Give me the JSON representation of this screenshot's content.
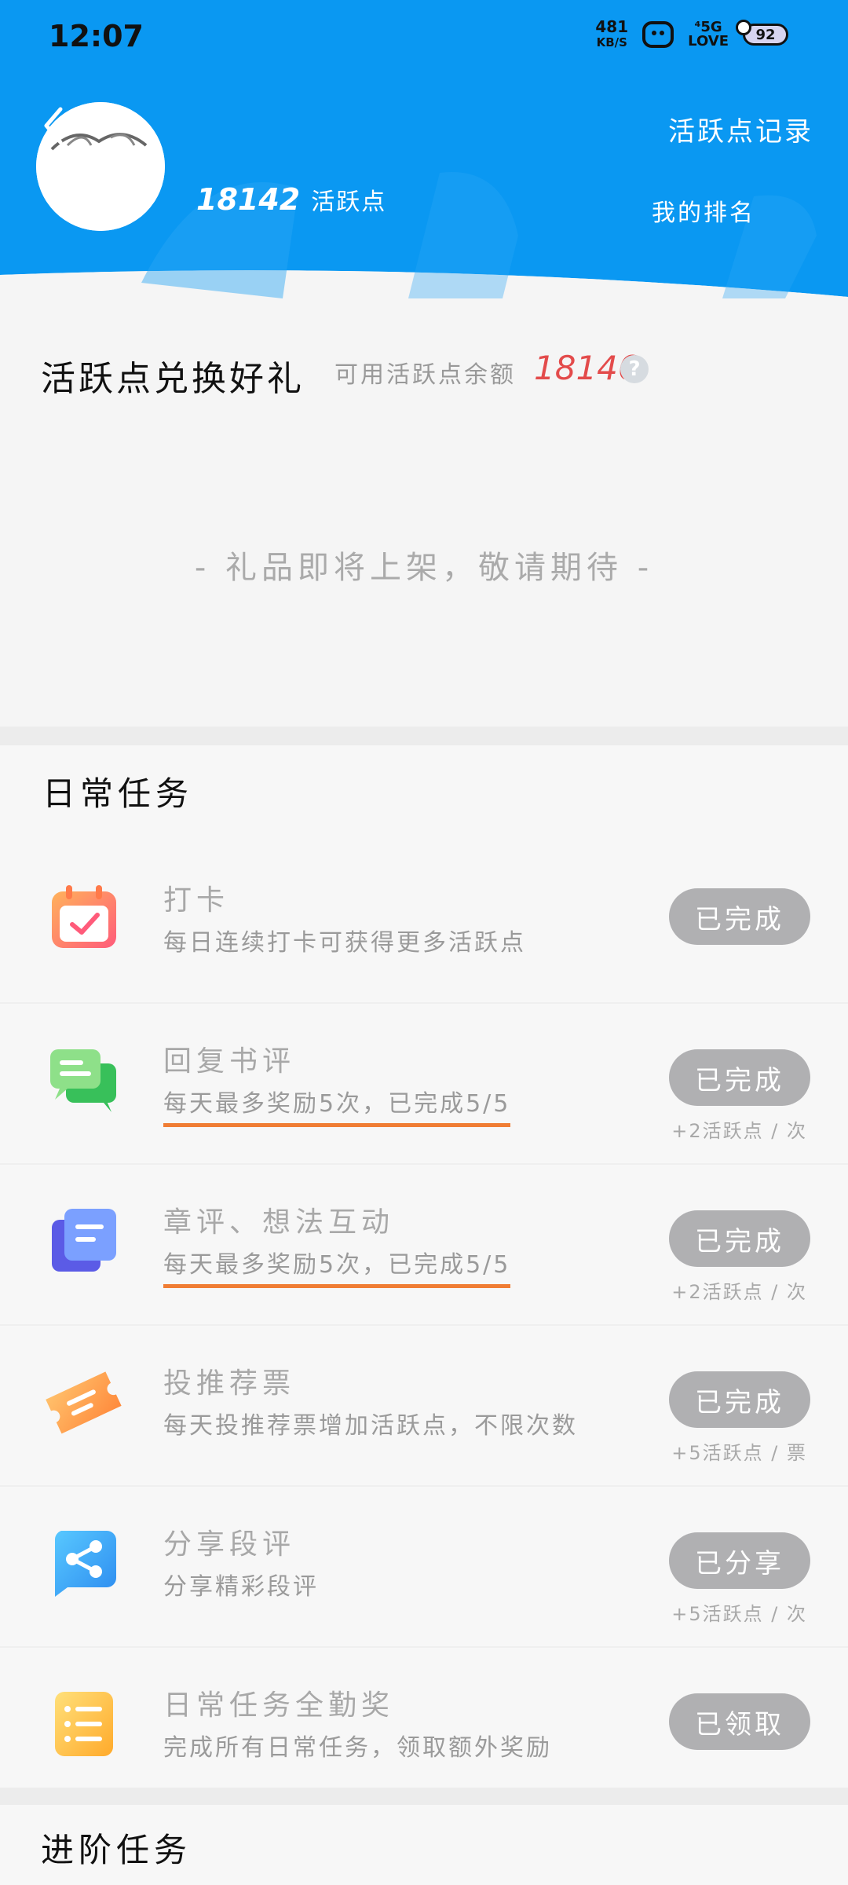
{
  "status_bar": {
    "time": "12:07",
    "net_speed": "481",
    "net_unit": "KB/S",
    "signal_top": "⁴5G",
    "signal_bottom": "LOVE",
    "battery": "92"
  },
  "header": {
    "record_link": "活跃点记录",
    "user_points_value": "18142",
    "user_points_label": "活跃点",
    "rank_link": "我的排名",
    "bg_color": "#0a98f2"
  },
  "exchange": {
    "title": "活跃点兑换好礼",
    "balance_label": "可用活跃点余额",
    "balance_value": "18146",
    "help": "?",
    "coming_soon": "- 礼品即将上架，敬请期待 -"
  },
  "daily": {
    "title": "日常任务",
    "tasks": [
      {
        "icon": "calendar-check-icon",
        "title": "打卡",
        "desc": "每日连续打卡可获得更多活跃点",
        "button": "已完成",
        "reward": ""
      },
      {
        "icon": "chat-bubbles-icon",
        "title": "回复书评",
        "desc": "每天最多奖励5次，已完成5/5",
        "button": "已完成",
        "reward": "+2活跃点 / 次"
      },
      {
        "icon": "document-stack-icon",
        "title": "章评、想法互动",
        "desc": "每天最多奖励5次，已完成5/5",
        "button": "已完成",
        "reward": "+2活跃点 / 次"
      },
      {
        "icon": "ticket-icon",
        "title": "投推荐票",
        "desc": "每天投推荐票增加活跃点，不限次数",
        "button": "已完成",
        "reward": "+5活跃点 / 票"
      },
      {
        "icon": "share-icon",
        "title": "分享段评",
        "desc": "分享精彩段评",
        "button": "已分享",
        "reward": "+5活跃点 / 次"
      },
      {
        "icon": "list-icon",
        "title": "日常任务全勤奖",
        "desc": "完成所有日常任务，领取额外奖励",
        "button": "已领取",
        "reward": ""
      }
    ]
  },
  "advanced": {
    "title": "进阶任务"
  }
}
